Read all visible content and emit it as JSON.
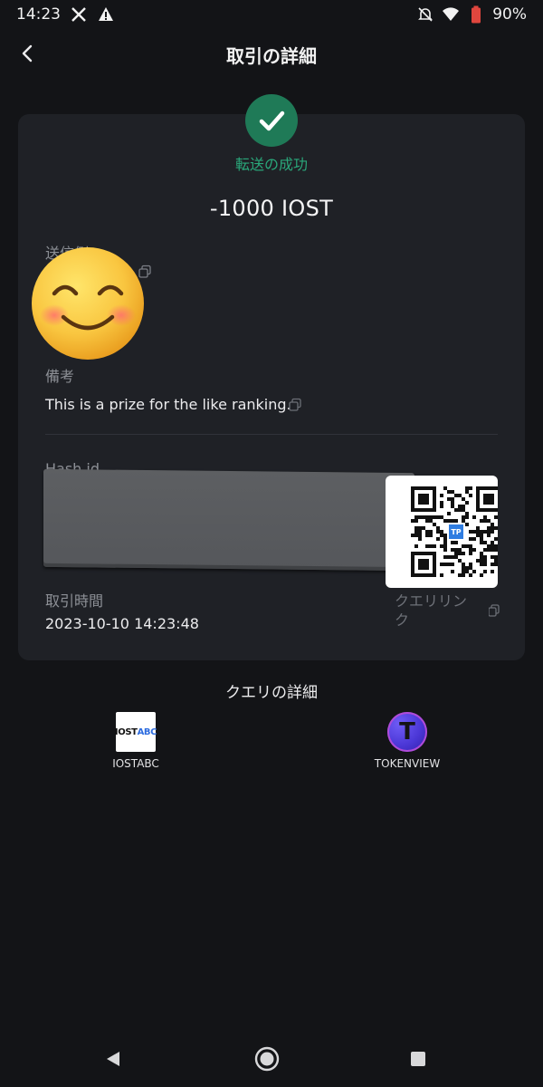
{
  "status_bar": {
    "time": "14:23",
    "battery": "90%",
    "icons": [
      "x-logo-icon",
      "warning-icon",
      "bell-off-icon",
      "wifi-icon",
      "battery-icon"
    ]
  },
  "header": {
    "title": "取引の詳細",
    "back_icon": "chevron-left-icon"
  },
  "transaction": {
    "status": "転送の成功",
    "status_color": "#2aa77a",
    "amount": "-1000 IOST",
    "sender_label": "送信側",
    "memo_label": "備考",
    "memo_value": "This is a prize for the like ranking.",
    "hash_label": "Hash id",
    "time_label": "取引時間",
    "time_value": "2023-10-10 14:23:48",
    "query_link_label": "クエリリンク"
  },
  "query": {
    "title": "クエリの詳細",
    "explorers": [
      {
        "name": "IOSTABC",
        "logo_main": "IOST",
        "logo_accent": "ABC"
      },
      {
        "name": "TOKENVIEW",
        "logo_letter": "T"
      }
    ]
  },
  "colors": {
    "background": "#131417",
    "card": "#1f2126",
    "success": "#1f7a57",
    "label": "#8d9096"
  }
}
